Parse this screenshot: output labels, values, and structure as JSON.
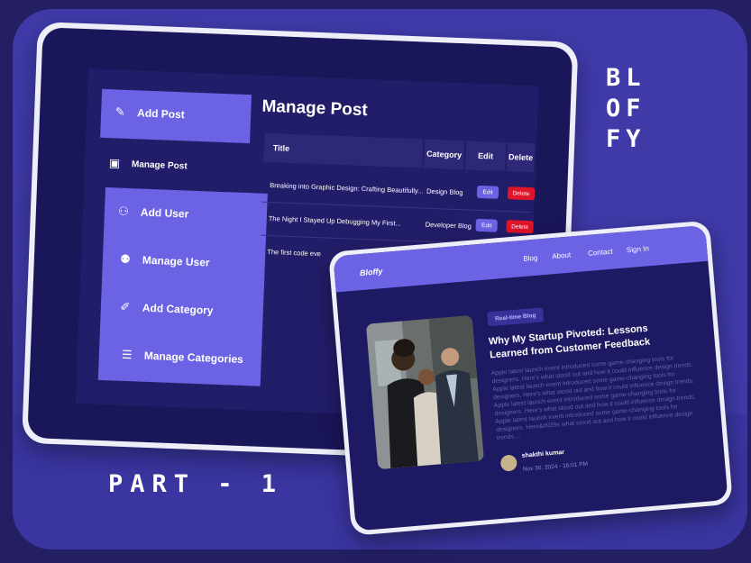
{
  "brand": {
    "lines": [
      "BL",
      "OF",
      "FY"
    ]
  },
  "caption": "PART - 1",
  "admin": {
    "sidebar": {
      "add_post": "Add Post",
      "manage_post": "Manage Post",
      "add_user": "Add User",
      "manage_user": "Manage User",
      "add_category": "Add Category",
      "manage_categories": "Manage Categories"
    },
    "heading": "Manage Post",
    "columns": [
      "Title",
      "Category",
      "Edit",
      "Delete"
    ],
    "rows": [
      {
        "title": "Breaking into Graphic Design: Crafting Beautifully...",
        "category": "Design Blog",
        "edit": "Edit",
        "delete": "Delete"
      },
      {
        "title": "The Night I Stayed Up Debugging My First...",
        "category": "Developer Blog",
        "edit": "Edit",
        "delete": "Delete"
      },
      {
        "title": "The first code eve",
        "category": "",
        "edit": "",
        "delete": ""
      }
    ]
  },
  "blog": {
    "logo": "Bloffy",
    "nav": [
      "Blog",
      "About",
      "Contact",
      "Sign In"
    ],
    "badge": "Real-time Blog",
    "title": "Why My Startup Pivoted: Lessons Learned from Customer Feedback",
    "body": "Apple latest launch event introduced some game-changing tools for designers. Here's what stood out and how it could influence design trends. Apple latest launch event introduced some game-changing tools for designers. Here's what stood out and how it could influence design trends. Apple latest launch event introduced some game-changing tools for designers. Here's what stood out and how it could influence design trends. Apple latest launch event introduced some game-changing tools for designers. Here&#039s what stood out and how it could influence design trends....",
    "author": "shakthi kumar",
    "date": "Nov 30, 2024 - 16:01 PM"
  },
  "colors": {
    "background": "#241f63",
    "card": "#3f3aa8",
    "accent": "#6b62e4",
    "delete": "#e0142a",
    "screen": "#1a165a"
  }
}
